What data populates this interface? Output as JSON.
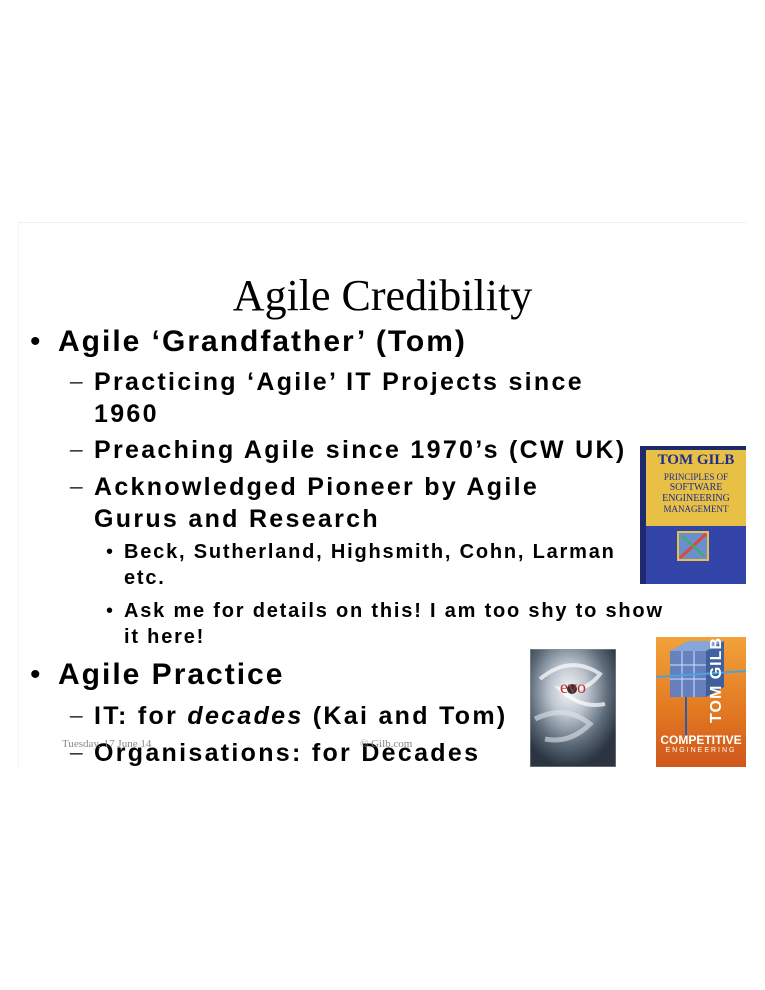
{
  "slide": {
    "title": "Agile Credibility",
    "bullets": [
      {
        "text": "Agile ‘Grandfather’ (Tom)",
        "subs": [
          {
            "text": "Practicing ‘Agile’ IT Projects since 1960"
          },
          {
            "text": "Preaching Agile since 1970’s (CW UK)"
          },
          {
            "text": "Acknowledged Pioneer by Agile Gurus and Research",
            "subs": [
              {
                "text": "Beck, Sutherland, Highsmith, Cohn, Larman etc."
              },
              {
                "text": "Ask me for details on this! I am too shy to show it here!"
              }
            ]
          }
        ]
      },
      {
        "text": "Agile Practice",
        "subs": [
          {
            "prefix": "IT: for ",
            "emph": "decades",
            "suffix": " (Kai and Tom)"
          },
          {
            "text": "Organisations: for Decades"
          }
        ]
      }
    ],
    "bullet_char": "•",
    "dash_char": "–",
    "footer": {
      "date": "Tuesday, 17 June 14",
      "copyright": "© Gilb.com"
    }
  },
  "books": {
    "principles": {
      "author": "TOM GILB",
      "title_lines": [
        "PRINCIPLES OF",
        "SOFTWARE",
        "ENGINEERING",
        "MANAGEMENT"
      ]
    },
    "evo": {
      "title": "evo"
    },
    "competitive": {
      "author": "TOM GILB",
      "title": "COMPETITIVE",
      "subtitle": "ENGINEERING"
    }
  }
}
